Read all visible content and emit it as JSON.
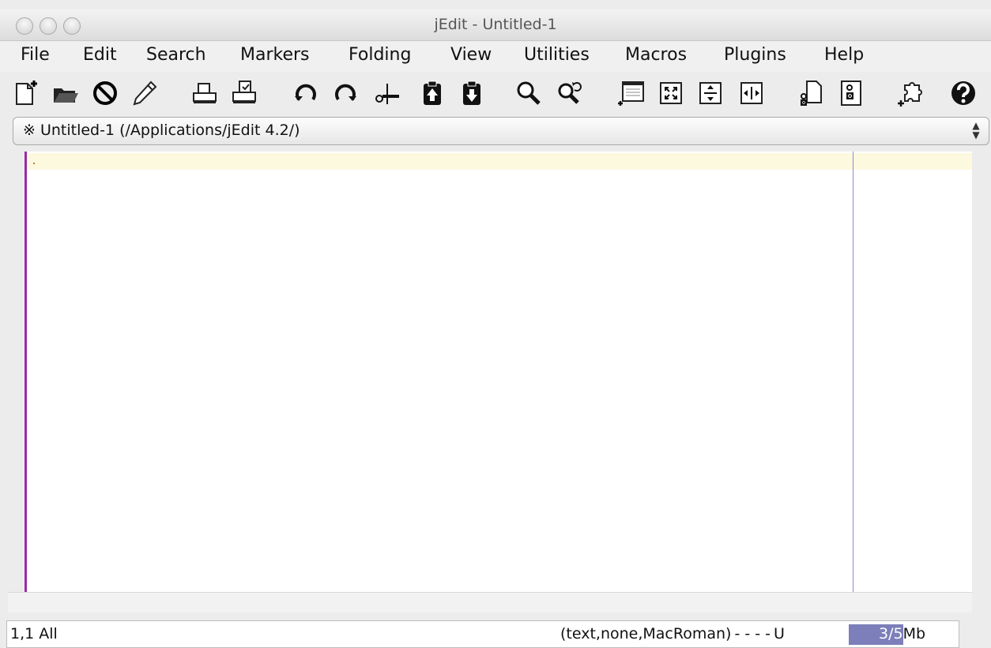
{
  "window": {
    "title": "jEdit - Untitled-1"
  },
  "menubar": {
    "items": [
      "File",
      "Edit",
      "Search",
      "Markers",
      "Folding",
      "View",
      "Utilities",
      "Macros",
      "Plugins",
      "Help"
    ]
  },
  "toolbar": {
    "icons": [
      "new-file-icon",
      "open-folder-icon",
      "close-icon",
      "edit-pencil-icon",
      "print-icon",
      "page-setup-icon",
      "undo-icon",
      "redo-icon",
      "cut-icon",
      "copy-icon",
      "paste-icon",
      "find-icon",
      "find-next-icon",
      "new-view-icon",
      "unsplit-icon",
      "split-horizontal-icon",
      "split-vertical-icon",
      "buffer-options-icon",
      "global-options-icon",
      "plugin-manager-icon",
      "help-icon"
    ]
  },
  "buffer_switcher": {
    "label": "※ Untitled-1 (/Applications/jEdit 4.2/)"
  },
  "editor": {
    "text": ""
  },
  "statusbar": {
    "caret_position": "1,1 All",
    "mode": "(text,none,MacRoman)",
    "flags": "- - - -",
    "wrap": "U",
    "memory_used": "3/5",
    "memory_unit": "Mb",
    "memory_fraction": 0.6
  },
  "colors": {
    "gutter_border": "#9b2aa6",
    "wrap_guide": "#8f8bd6",
    "current_line": "#fcf9df",
    "memory_bar": "#7c7fb9"
  }
}
